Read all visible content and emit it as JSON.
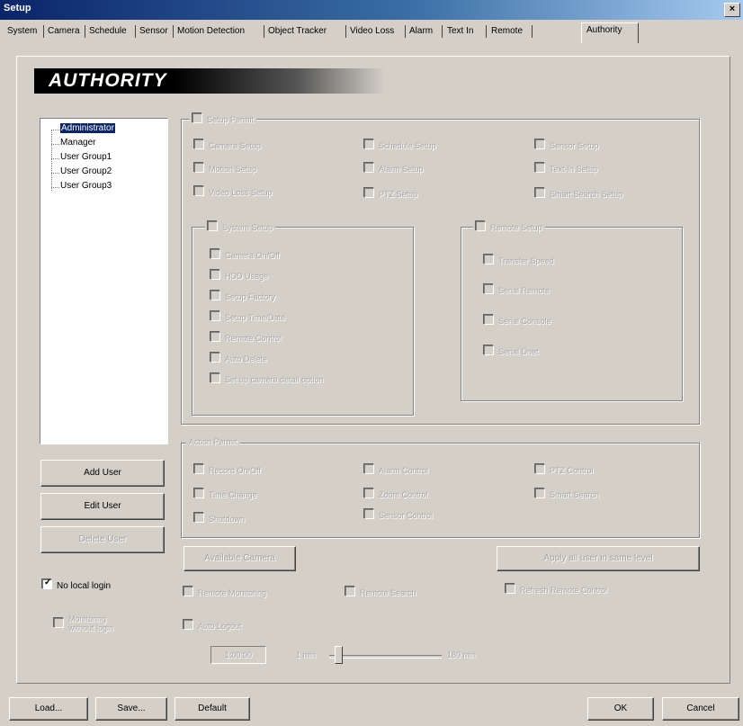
{
  "window": {
    "title": "Setup",
    "close_glyph": "×"
  },
  "tabs": [
    "System",
    "Camera",
    "Schedule",
    "Sensor",
    "Motion Detection",
    "Object Tracker",
    "Video Loss",
    "Alarm",
    "Text In",
    "Remote",
    "Authority"
  ],
  "active_tab": "Authority",
  "banner": "AUTHORITY",
  "tree": {
    "items": [
      "Administrator",
      "Manager",
      "User Group1",
      "User Group2",
      "User Group3"
    ],
    "selected": "Administrator"
  },
  "setup_permit": {
    "label": "Setup Permit",
    "items": [
      "Camera Setup",
      "Schedule Setup",
      "Sensor Setup",
      "Motion Setup",
      "Alarm Setup",
      "Text-In Setup",
      "Video Loss Setup",
      "PTZ Setup",
      "Smart Search Setup"
    ]
  },
  "system_setup": {
    "label": "System Setup",
    "items": [
      "Camera On/Off",
      "HDD Usage",
      "Setup Factory",
      "Setup Time/Date",
      "Remote Control",
      "Auto Delete",
      "Set up camera detail option"
    ]
  },
  "remote_setup": {
    "label": "Remote Setup",
    "items": [
      "Transfer Speed",
      "Serial Remote",
      "Serial Console",
      "Serial Dnet"
    ]
  },
  "action_permit": {
    "label": "Action Permit",
    "items": [
      "Record On/Off",
      "Alarm Control",
      "PTZ Control",
      "Time Change",
      "Zoom Control",
      "Smart Search",
      "Shutdown",
      "Sensor Control"
    ]
  },
  "buttons": {
    "add_user": "Add User",
    "edit_user": "Edit User",
    "delete_user": "Delete User",
    "available_camera": "Available Camera",
    "apply_all": "Apply all user in same level",
    "load": "Load...",
    "save": "Save...",
    "default": "Default",
    "ok": "OK",
    "cancel": "Cancel"
  },
  "left_options": {
    "no_local_login": "No local login",
    "no_local_login_checked": true,
    "monitoring_without_login": "Monitoring without login"
  },
  "bottom_options": {
    "remote_monitoring": "Remote Monitoring",
    "remote_search": "Remote Search",
    "refresh_remote_control": "Refresh Remote Control",
    "auto_logout": "Auto Logout"
  },
  "auto_logout": {
    "time_value": "1:00:00",
    "slider_min_label": "1 min",
    "slider_max_label": "180 min",
    "slider_level": 0.05
  }
}
